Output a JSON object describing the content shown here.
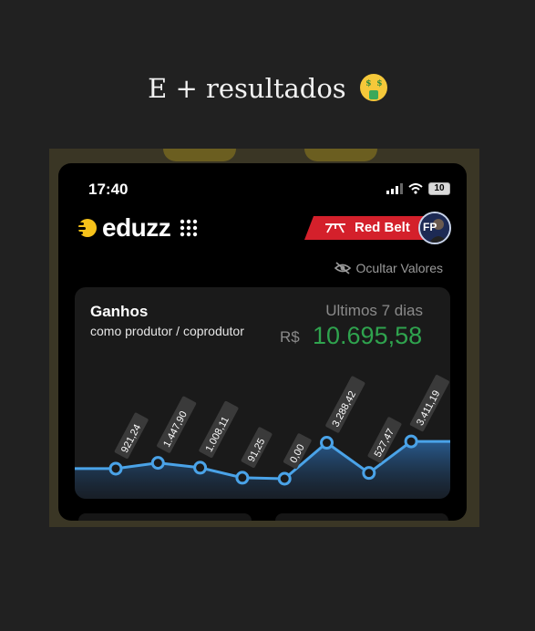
{
  "caption": {
    "text": "E + resultados",
    "emoji": "money-mouth-face-icon"
  },
  "status_bar": {
    "time": "17:40",
    "battery": "10"
  },
  "header": {
    "brand": "eduzz",
    "belt_label": "Red Belt",
    "avatar_initials": "FP"
  },
  "hide_values": {
    "label": "Ocultar Valores"
  },
  "earnings_card": {
    "title": "Ganhos",
    "subtitle": "como produtor / coprodutor",
    "period": "Ultimos 7 dias",
    "currency": "R$",
    "total": "10.695,58"
  },
  "colors": {
    "background": "#212121",
    "accent_yellow": "#f6c21a",
    "belt_red": "#d4202b",
    "total_green": "#2fa34e",
    "line_blue": "#4aa3e8"
  },
  "chart_data": {
    "type": "area",
    "categories": [
      "1",
      "2",
      "3",
      "4",
      "5",
      "6",
      "7",
      "8"
    ],
    "labels": [
      "921,24",
      "1.447,90",
      "1.008,11",
      "91,25",
      "0,00",
      "3.288,42",
      "527,47",
      "3.411,19"
    ],
    "values": [
      921.24,
      1447.9,
      1008.11,
      91.25,
      0.0,
      3288.42,
      527.47,
      3411.19
    ],
    "ylim": [
      0,
      3500
    ],
    "grid": false,
    "legend": "none"
  }
}
